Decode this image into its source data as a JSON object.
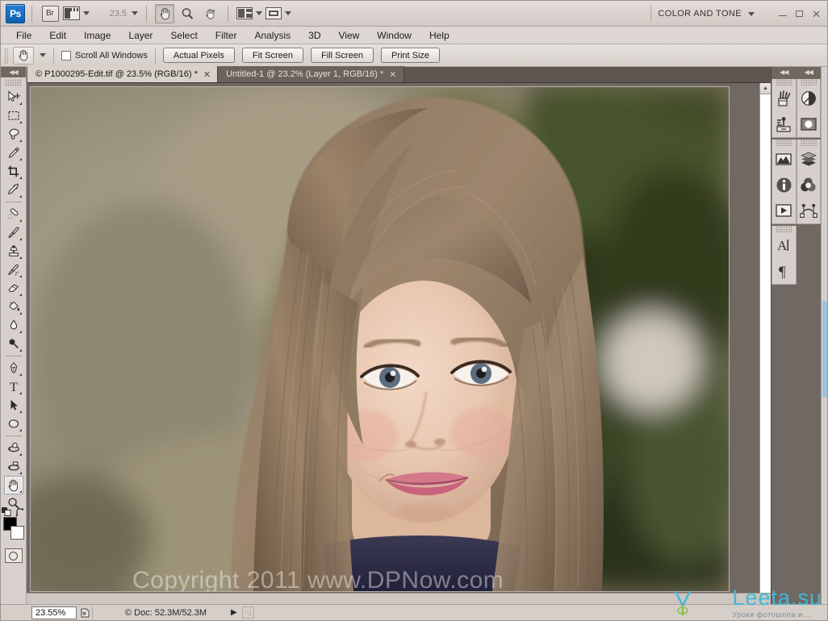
{
  "app": {
    "name": "Adobe Photoshop",
    "logo_text": "Ps",
    "workspace": "COLOR AND TONE",
    "zoom_top": "23.5"
  },
  "titlebar": {
    "bridge_label": "Br",
    "mini_bridge_icon": "mini-bridge-icon",
    "view_extras_icon": "view-extras-icon",
    "arrange_documents_icon": "arrange-documents-icon",
    "screen_mode_icon": "screen-mode-icon",
    "hand_icon": "hand-tool-icon",
    "zoom_icon": "zoom-tool-icon",
    "rotate_icon": "rotate-view-tool-icon",
    "minimize": "–",
    "maximize": "□",
    "close": "✕"
  },
  "menubar": {
    "items": [
      {
        "label": "File"
      },
      {
        "label": "Edit"
      },
      {
        "label": "Image"
      },
      {
        "label": "Layer"
      },
      {
        "label": "Select"
      },
      {
        "label": "Filter"
      },
      {
        "label": "Analysis"
      },
      {
        "label": "3D"
      },
      {
        "label": "View"
      },
      {
        "label": "Window"
      },
      {
        "label": "Help"
      }
    ]
  },
  "optionsbar": {
    "tool_icon": "hand-tool-icon",
    "scroll_all_windows_label": "Scroll All Windows",
    "scroll_all_windows_checked": false,
    "buttons": [
      {
        "label": "Actual Pixels"
      },
      {
        "label": "Fit Screen"
      },
      {
        "label": "Fill Screen"
      },
      {
        "label": "Print Size"
      }
    ]
  },
  "tabs": [
    {
      "label": "© P1000295-Edit.tif @ 23.5% (RGB/16) *",
      "close": "✕",
      "active": true
    },
    {
      "label": "Untitled-1 @ 23.2% (Layer 1, RGB/16) *",
      "close": "✕",
      "active": false
    }
  ],
  "toolbar": {
    "tools": [
      {
        "name": "move-tool",
        "icon": "move-tool-icon",
        "has_flyout": true,
        "active": false
      },
      {
        "name": "rectangular-marquee-tool",
        "icon": "marquee-tool-icon",
        "has_flyout": true,
        "active": false
      },
      {
        "name": "lasso-tool",
        "icon": "lasso-tool-icon",
        "has_flyout": true,
        "active": false
      },
      {
        "name": "quick-selection-tool",
        "icon": "quick-selection-tool-icon",
        "has_flyout": true,
        "active": false
      },
      {
        "name": "crop-tool",
        "icon": "crop-tool-icon",
        "has_flyout": true,
        "active": false
      },
      {
        "name": "eyedropper-tool",
        "icon": "eyedropper-tool-icon",
        "has_flyout": true,
        "active": false
      },
      {
        "name": "spot-healing-brush-tool",
        "icon": "healing-brush-tool-icon",
        "has_flyout": true,
        "active": false
      },
      {
        "name": "brush-tool",
        "icon": "brush-tool-icon",
        "has_flyout": true,
        "active": false
      },
      {
        "name": "clone-stamp-tool",
        "icon": "clone-stamp-tool-icon",
        "has_flyout": true,
        "active": false
      },
      {
        "name": "history-brush-tool",
        "icon": "history-brush-tool-icon",
        "has_flyout": true,
        "active": false
      },
      {
        "name": "eraser-tool",
        "icon": "eraser-tool-icon",
        "has_flyout": true,
        "active": false
      },
      {
        "name": "gradient-tool",
        "icon": "paint-bucket-tool-icon",
        "has_flyout": true,
        "active": false
      },
      {
        "name": "blur-tool",
        "icon": "blur-tool-icon",
        "has_flyout": true,
        "active": false
      },
      {
        "name": "dodge-tool",
        "icon": "dodge-tool-icon",
        "has_flyout": true,
        "active": false
      },
      {
        "name": "pen-tool",
        "icon": "pen-tool-icon",
        "has_flyout": true,
        "active": false
      },
      {
        "name": "horizontal-type-tool",
        "icon": "type-tool-icon",
        "has_flyout": true,
        "active": false
      },
      {
        "name": "path-selection-tool",
        "icon": "path-selection-tool-icon",
        "has_flyout": true,
        "active": false
      },
      {
        "name": "ellipse-shape-tool",
        "icon": "shape-tool-icon",
        "has_flyout": true,
        "active": false
      },
      {
        "name": "3d-object-rotate-tool",
        "icon": "3d-object-rotate-tool-icon",
        "has_flyout": true,
        "active": false
      },
      {
        "name": "3d-camera-rotate-tool",
        "icon": "3d-camera-rotate-tool-icon",
        "has_flyout": true,
        "active": false
      },
      {
        "name": "hand-tool",
        "icon": "hand-tool-icon",
        "has_flyout": true,
        "active": true
      },
      {
        "name": "zoom-tool",
        "icon": "zoom-tool-icon",
        "has_flyout": false,
        "active": false
      }
    ],
    "foreground_color": "#000000",
    "background_color": "#ffffff",
    "quick_mask_icon": "quick-mask-icon"
  },
  "dock": {
    "columns": [
      {
        "groups": [
          {
            "buttons": [
              {
                "name": "brush-presets-panel",
                "icon": "brush-presets-icon"
              },
              {
                "name": "mini-bridge-panel",
                "icon": "mini-bridge-panel-icon"
              }
            ]
          },
          {
            "buttons": [
              {
                "name": "histogram-panel",
                "icon": "histogram-icon"
              },
              {
                "name": "info-panel",
                "icon": "info-icon"
              },
              {
                "name": "actions-panel",
                "icon": "actions-play-icon"
              }
            ]
          },
          {
            "buttons": [
              {
                "name": "character-panel",
                "icon": "character-icon"
              },
              {
                "name": "paragraph-panel",
                "icon": "paragraph-icon"
              }
            ]
          }
        ]
      },
      {
        "groups": [
          {
            "buttons": [
              {
                "name": "adjustments-panel",
                "icon": "adjustments-icon"
              },
              {
                "name": "masks-panel",
                "icon": "masks-icon"
              }
            ]
          },
          {
            "buttons": [
              {
                "name": "layers-panel",
                "icon": "layers-icon"
              },
              {
                "name": "channels-panel",
                "icon": "channels-icon"
              },
              {
                "name": "paths-panel",
                "icon": "paths-icon"
              }
            ]
          }
        ]
      }
    ],
    "collapse_glyph": "◀◀"
  },
  "statusbar": {
    "zoom_value": "23.55%",
    "preview_icon": "preview-icon",
    "doc_info": "Doc: 52.3M/52.3M",
    "doc_info_prefix": "©",
    "arrow_glyph": "▶"
  },
  "canvas": {
    "watermark": "Copyright 2011 www.DPNow.com",
    "logo_word": "Leeta.su",
    "logo_tagline": "Уроки фотошопа и...",
    "photo_alt": "portrait of a girl with long light-brown hair in a dark navy top, blurred green and grey outdoor background"
  },
  "colors": {
    "chrome": "#d6cfcb",
    "chrome_dark": "#706862",
    "accent_blue": "#1f6fc4",
    "logo_cyan": "#3fb9d8"
  }
}
